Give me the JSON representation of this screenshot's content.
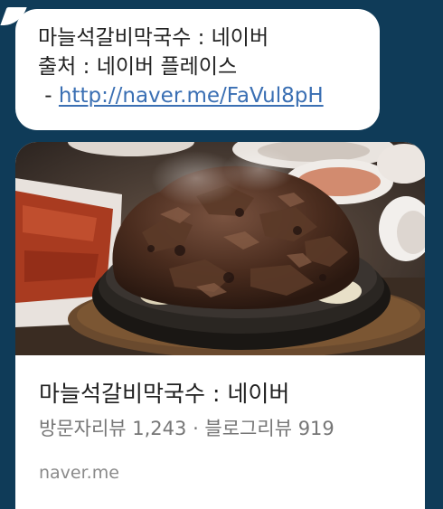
{
  "message": {
    "line1": "마늘석갈비막국수 : 네이버",
    "line2": "출처 : 네이버 플레이스",
    "link_prefix": " - ",
    "link_text": "http://naver.me/FaVul8pH"
  },
  "link_preview": {
    "title": "마늘석갈비막국수 : 네이버",
    "subtitle": "방문자리뷰 1,243 · 블로그리뷰 919",
    "domain": "naver.me",
    "image": "grilled-pork-ribs-on-stone-plate"
  },
  "colors": {
    "background": "#0f3b58",
    "bubble": "#ffffff",
    "link": "#3a6fb3"
  }
}
